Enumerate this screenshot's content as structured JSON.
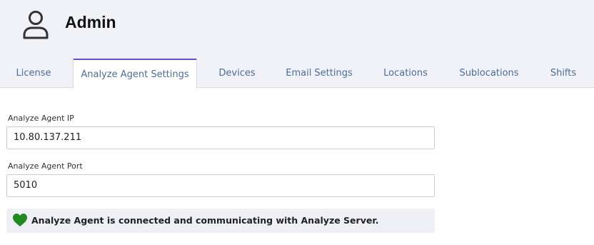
{
  "header": {
    "title": "Admin",
    "icon": "user-icon"
  },
  "tabs": [
    {
      "label": "License",
      "active": false
    },
    {
      "label": "Analyze Agent Settings",
      "active": true
    },
    {
      "label": "Devices",
      "active": false
    },
    {
      "label": "Email Settings",
      "active": false
    },
    {
      "label": "Locations",
      "active": false
    },
    {
      "label": "Sublocations",
      "active": false
    },
    {
      "label": "Shifts",
      "active": false
    }
  ],
  "form": {
    "ip_label": "Analyze Agent IP",
    "ip_value": "10.80.137.211",
    "port_label": "Analyze Agent Port",
    "port_value": "5010"
  },
  "status": {
    "icon": "heart-icon",
    "color": "#1f8a1f",
    "text": "Analyze Agent is connected and communicating with Analyze Server."
  },
  "colors": {
    "accent": "#6a4fc7",
    "tab_text": "#4a6d9a",
    "header_bg": "#f1f2f7"
  }
}
